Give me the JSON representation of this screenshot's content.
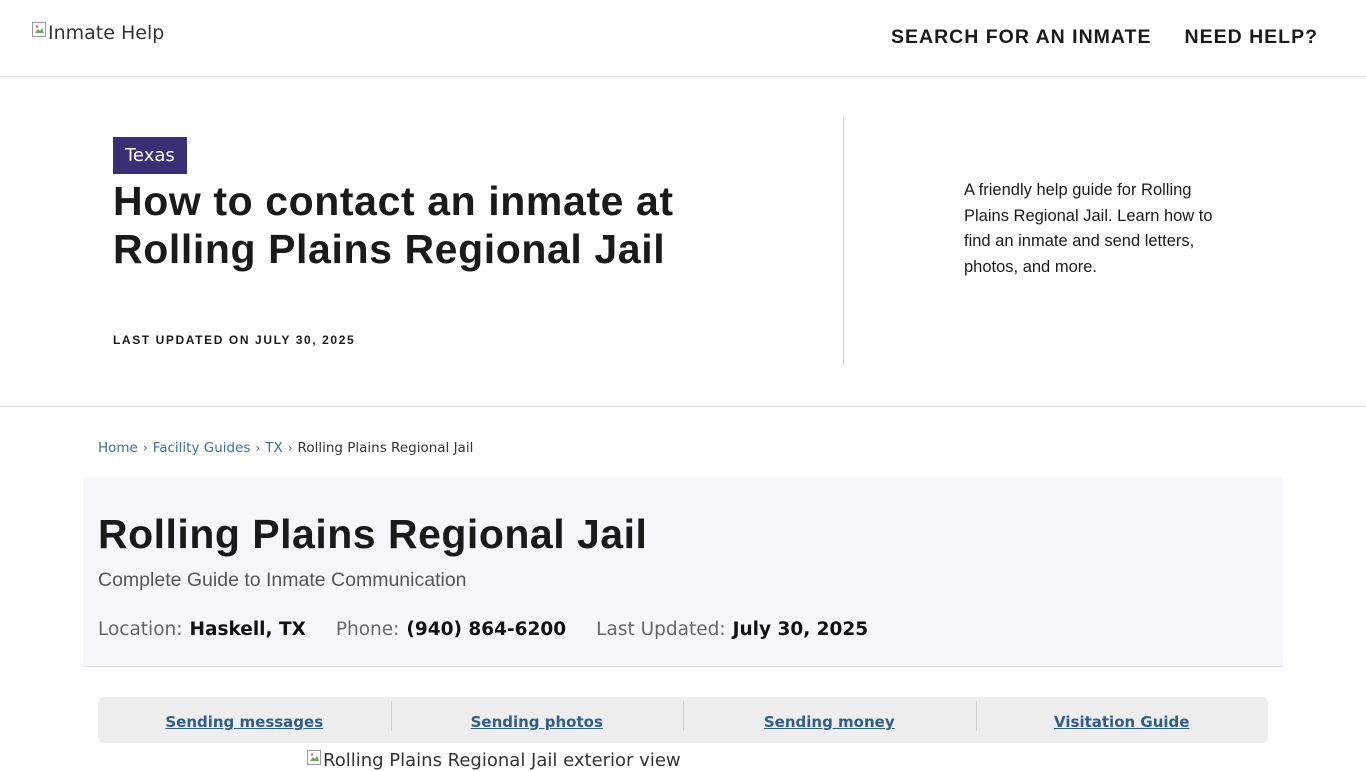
{
  "header": {
    "logo_alt": "Inmate Help",
    "nav": [
      {
        "label": "SEARCH FOR AN INMATE"
      },
      {
        "label": "NEED HELP?"
      }
    ]
  },
  "hero": {
    "state_badge": "Texas",
    "title": "How to contact an inmate at Rolling Plains Regional Jail",
    "updated": "LAST UPDATED ON JULY 30, 2025",
    "description": "A friendly help guide for Rolling Plains Regional Jail. Learn how to find an inmate and send letters, photos, and more.",
    "badge_color": "#3a2e77"
  },
  "breadcrumb": {
    "items": [
      {
        "label": "Home"
      },
      {
        "label": "Facility Guides"
      },
      {
        "label": "TX"
      }
    ],
    "current": "Rolling Plains Regional Jail",
    "separator": "›"
  },
  "facility": {
    "title": "Rolling Plains Regional Jail",
    "subtitle": "Complete Guide to Inmate Communication",
    "location_label": "Location:",
    "location_value": "Haskell, TX",
    "phone_label": "Phone:",
    "phone_value": "(940) 864-6200",
    "updated_label": "Last Updated:",
    "updated_value": "July 30, 2025"
  },
  "guide_tabs": [
    {
      "label": "Sending messages"
    },
    {
      "label": "Sending photos"
    },
    {
      "label": "Sending money"
    },
    {
      "label": "Visitation Guide"
    }
  ],
  "exterior_image": {
    "alt": "Rolling Plains Regional Jail exterior view"
  },
  "colors": {
    "link": "#3a6ea5",
    "tab_link": "#2f5d8c",
    "panel_bg": "#f5f7fa"
  }
}
